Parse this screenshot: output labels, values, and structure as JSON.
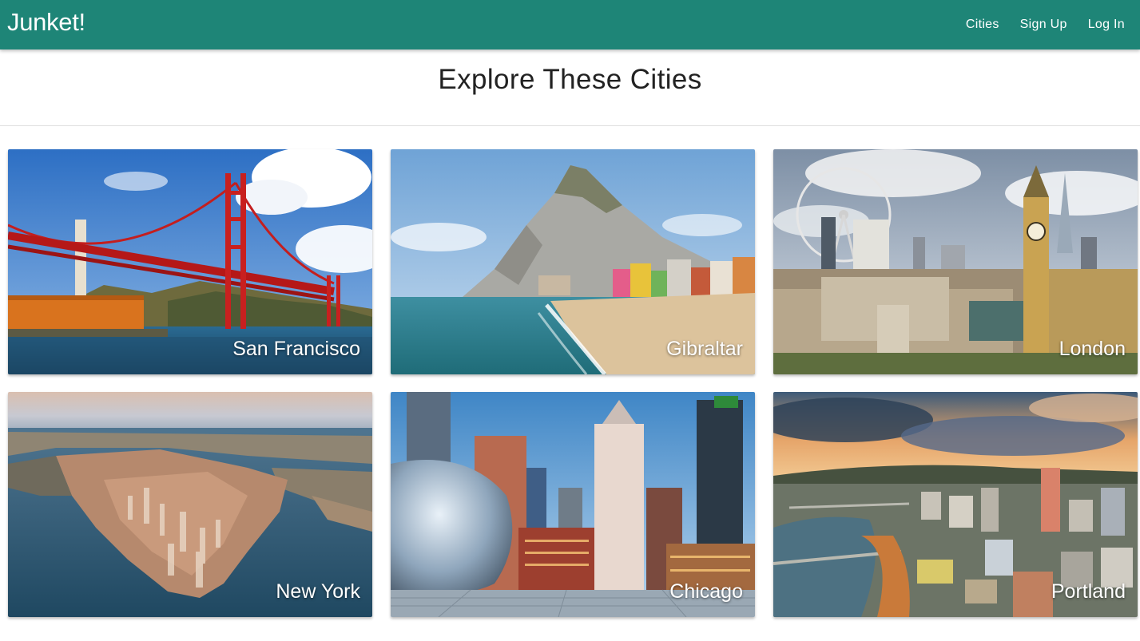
{
  "navbar": {
    "brand": "Junket!",
    "links": [
      "Cities",
      "Sign Up",
      "Log In"
    ],
    "background": "#1e8577"
  },
  "page": {
    "title": "Explore These Cities"
  },
  "cities": [
    {
      "name": "San Francisco"
    },
    {
      "name": "Gibraltar"
    },
    {
      "name": "London"
    },
    {
      "name": "New York"
    },
    {
      "name": "Chicago"
    },
    {
      "name": "Portland"
    }
  ]
}
